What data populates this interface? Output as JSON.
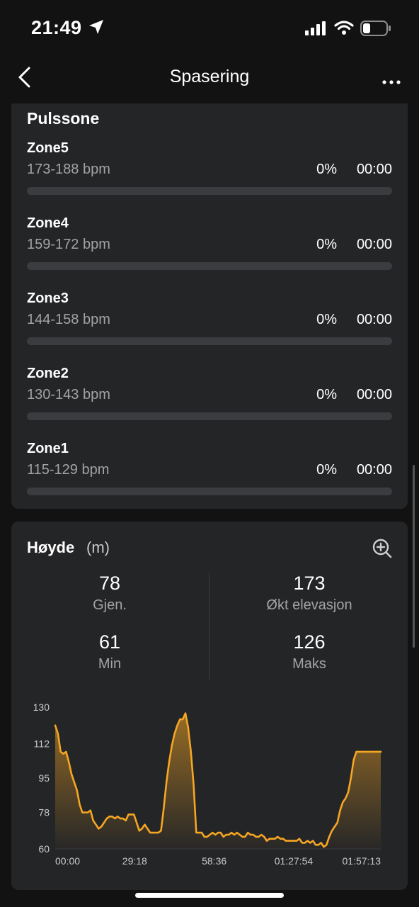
{
  "status_bar": {
    "time": "21:49"
  },
  "header": {
    "title": "Spasering"
  },
  "pulse": {
    "title": "Pulssone",
    "zones": [
      {
        "name": "Zone5",
        "range": "173-188 bpm",
        "percent": "0%",
        "time": "00:00",
        "fill": 0
      },
      {
        "name": "Zone4",
        "range": "159-172 bpm",
        "percent": "0%",
        "time": "00:00",
        "fill": 0
      },
      {
        "name": "Zone3",
        "range": "144-158 bpm",
        "percent": "0%",
        "time": "00:00",
        "fill": 0
      },
      {
        "name": "Zone2",
        "range": "130-143 bpm",
        "percent": "0%",
        "time": "00:00",
        "fill": 0
      },
      {
        "name": "Zone1",
        "range": "115-129 bpm",
        "percent": "0%",
        "time": "00:00",
        "fill": 0
      }
    ]
  },
  "elevation": {
    "title": "Høyde",
    "unit": "(m)",
    "stats": [
      {
        "value": "78",
        "label": "Gjen."
      },
      {
        "value": "173",
        "label": "Økt elevasjon"
      },
      {
        "value": "61",
        "label": "Min"
      },
      {
        "value": "126",
        "label": "Maks"
      }
    ]
  },
  "colors": {
    "accent": "#f5a623",
    "card": "#242527",
    "background": "#121212"
  },
  "chart_data": {
    "type": "area",
    "y_ticks": [
      "130",
      "112",
      "95",
      "78",
      "60"
    ],
    "x_ticks": [
      "00:00",
      "29:18",
      "58:36",
      "01:27:54",
      "01:57:13"
    ],
    "ylim": [
      60,
      130
    ],
    "xlim": [
      0,
      120
    ],
    "x_tick_positions": [
      0,
      29.3,
      58.6,
      87.9,
      117.2
    ],
    "x": [
      0,
      1,
      2,
      3,
      4,
      5,
      6,
      7,
      8,
      9,
      10,
      11,
      12,
      13,
      14,
      15,
      16,
      17,
      18,
      19,
      20,
      21,
      22,
      23,
      24,
      25,
      26,
      27,
      28,
      29,
      30,
      31,
      32,
      33,
      34,
      35,
      36,
      37,
      38,
      39,
      40,
      41,
      42,
      43,
      44,
      45,
      46,
      47,
      48,
      49,
      50,
      51,
      52,
      53,
      54,
      55,
      56,
      57,
      58,
      59,
      60,
      61,
      62,
      63,
      64,
      65,
      66,
      67,
      68,
      69,
      70,
      71,
      72,
      73,
      74,
      75,
      76,
      77,
      78,
      79,
      80,
      81,
      82,
      83,
      84,
      85,
      86,
      87,
      88,
      89,
      90,
      91,
      92,
      93,
      94,
      95,
      96,
      97,
      98,
      99,
      100,
      101,
      102,
      103,
      104,
      105,
      106,
      107,
      108,
      109,
      110,
      111,
      112,
      113,
      114,
      115,
      116,
      117,
      118,
      119,
      120
    ],
    "y": [
      121,
      117,
      108,
      107,
      108,
      103,
      97,
      93,
      89,
      82,
      78,
      78,
      78,
      79,
      74,
      72,
      70,
      71,
      73,
      75,
      76,
      76,
      75,
      76,
      75,
      75,
      74,
      77,
      77,
      77,
      73,
      69,
      70,
      72,
      70,
      68,
      68,
      68,
      68,
      69,
      80,
      93,
      103,
      111,
      117,
      121,
      124,
      124,
      127,
      120,
      108,
      92,
      68,
      68,
      68,
      66,
      66,
      67,
      68,
      67,
      68,
      68,
      66,
      67,
      67,
      68,
      67,
      68,
      67,
      66,
      66,
      68,
      67,
      67,
      66,
      66,
      67,
      66,
      64,
      65,
      65,
      65,
      66,
      65,
      65,
      64,
      64,
      64,
      64,
      64,
      65,
      63,
      63,
      64,
      63,
      64,
      62,
      62,
      63,
      61,
      62,
      66,
      69,
      71,
      73,
      79,
      83,
      85,
      88,
      95,
      104,
      108,
      108,
      108,
      108,
      108,
      108,
      108,
      108,
      108,
      108
    ]
  }
}
